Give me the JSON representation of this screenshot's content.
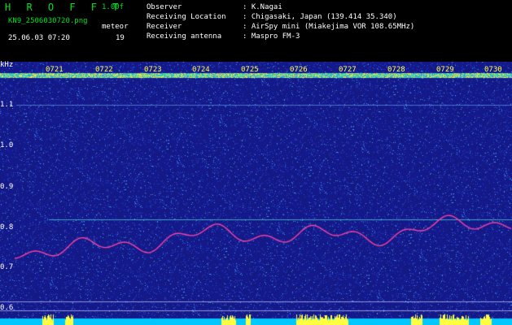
{
  "header": {
    "logo": "H R O F F T",
    "version": "1.00f",
    "file": "KN9_2506030720.png",
    "datetime": "25.06.03 07:20",
    "meteor_label": "meteor",
    "meteor_count": "19",
    "fields": [
      {
        "label": "Observer",
        "value": ": K.Nagai"
      },
      {
        "label": "Receiving Location",
        "value": ": Chigasaki, Japan (139.414 35.340)"
      },
      {
        "label": "Receiver",
        "value": ": AirSpy mini (Miakejima VOR 108.65MHz)"
      },
      {
        "label": "Receiving antenna",
        "value": ": Maspro FM-3"
      }
    ]
  },
  "axis": {
    "unit": "kHz",
    "y_labels": [
      "1.1",
      "1.0",
      "0.9",
      "0.8",
      "0.7",
      "0.6"
    ],
    "time_labels": [
      "0721",
      "0722",
      "0723",
      "0724",
      "0725",
      "0726",
      "0727",
      "0728",
      "0729",
      "0730"
    ]
  },
  "colors": {
    "background": "#1a1f8a",
    "header_green": "#00e020",
    "label_yellow": "#ffff40",
    "trace": "#ff40a0",
    "bottom_band": "#00c8ff"
  }
}
